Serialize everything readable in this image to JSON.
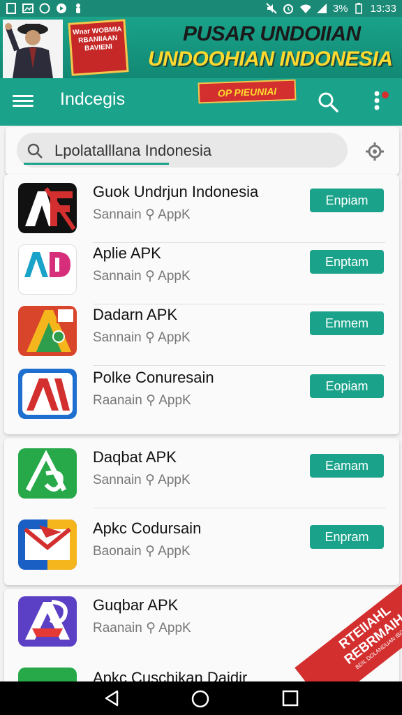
{
  "status_bar": {
    "time": "13:33",
    "battery": "3%",
    "icons": [
      "pdf-icon",
      "gallery-icon",
      "whatsapp-icon",
      "youtube-icon",
      "notification-icon",
      "mute-icon",
      "alarm-icon",
      "wifi-icon",
      "signal-icon",
      "battery-icon"
    ]
  },
  "banner": {
    "line1": "PUSAR UNDOIIAN",
    "line2": "UNDOOHIAN INDONESIA",
    "badge_text": "Wnar WOBMIA RBANIIAAN BAVIENI"
  },
  "app_bar": {
    "title": "Indcegis",
    "promo": "OP PIEUNIAI"
  },
  "search": {
    "value": "Lpolatalllana Indonesia"
  },
  "colors": {
    "accent": "#1aa38a",
    "button": "#1aa38a",
    "ribbon": "#d32f2f",
    "banner_title": "#ffd92e"
  },
  "apps": [
    {
      "name": "Guok Undrjun Indonesia",
      "developer": "Sannain",
      "type": "AppK",
      "button": "Enpiam",
      "icon": "app-icon-af"
    },
    {
      "name": "Aplie APK",
      "developer": "Sannain",
      "type": "AppK",
      "button": "Enptam",
      "icon": "app-icon-ad"
    },
    {
      "name": "Dadarn APK",
      "developer": "Sannain",
      "type": "AppK",
      "button": "Enmem",
      "icon": "app-icon-a-colorful"
    },
    {
      "name": "Polke Conuresain",
      "developer": "Raanain",
      "type": "AppK",
      "button": "Eopiam",
      "icon": "app-icon-ai"
    },
    {
      "name": "Daqbat APK",
      "developer": "Sannain",
      "type": "AppK",
      "button": "Eamam",
      "icon": "app-icon-green-a"
    },
    {
      "name": "Apkc Codursain",
      "developer": "Baonain",
      "type": "AppK",
      "button": "Enpram",
      "icon": "app-icon-envelope"
    },
    {
      "name": "Guqbar APK",
      "developer": "Raanain",
      "type": "AppK",
      "icon": "app-icon-purple-a"
    },
    {
      "name": "Apkc Cuschikan Daidir"
    }
  ],
  "ribbon": {
    "line1": "RTEIIAHL",
    "line2": "REBRMAIH",
    "small": "BDIL DOLANDUAN IBOA"
  }
}
